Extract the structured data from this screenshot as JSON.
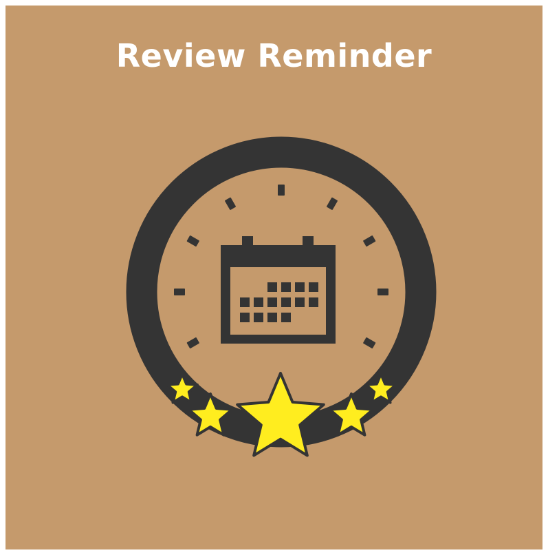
{
  "title": "Review Reminder",
  "colors": {
    "background": "#c59a6c",
    "ring": "#343434",
    "star_fill": "#ffed1f",
    "star_stroke": "#343434",
    "title_text": "#ffffff"
  },
  "icons": {
    "ring": "clock-ring-icon",
    "calendar": "calendar-icon",
    "stars": "star-icon"
  },
  "rating": {
    "stars": 5
  }
}
